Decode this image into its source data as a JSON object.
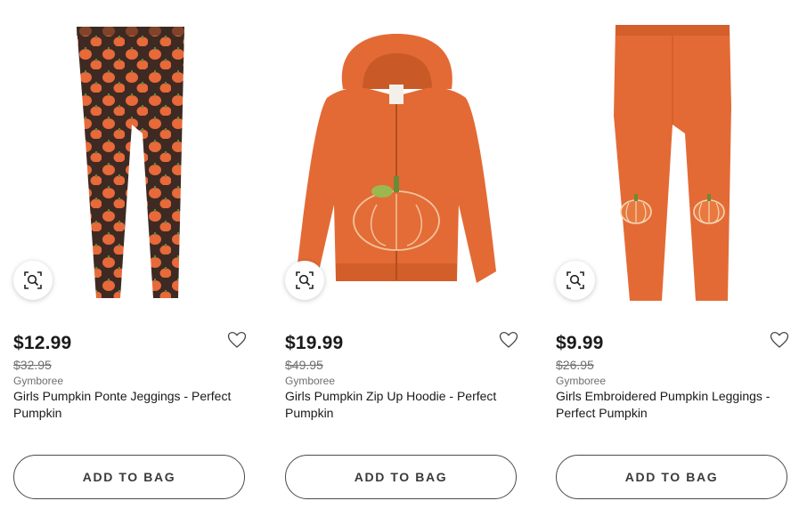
{
  "colors": {
    "accent": "#e8693a",
    "pumpkin_dark": "#cf5a24",
    "legging_print_bg": "#3e2a22",
    "stem_green": "#5e8b3a",
    "text": "#1a1a1a",
    "muted": "#6f6f6f"
  },
  "products": [
    {
      "image_icon": "pumpkin-print-leggings-image",
      "quickview_icon": "search-zoom-icon",
      "favorite_icon": "heart-outline-icon",
      "price": "$12.99",
      "original_price": "$32.95",
      "brand": "Gymboree",
      "title": "Girls Pumpkin Ponte Jeggings - Perfect Pumpkin",
      "cta": "ADD TO BAG"
    },
    {
      "image_icon": "pumpkin-zip-hoodie-image",
      "quickview_icon": "search-zoom-icon",
      "favorite_icon": "heart-outline-icon",
      "price": "$19.99",
      "original_price": "$49.95",
      "brand": "Gymboree",
      "title": "Girls Pumpkin Zip Up Hoodie - Perfect Pumpkin",
      "cta": "ADD TO BAG"
    },
    {
      "image_icon": "embroidered-pumpkin-leggings-image",
      "quickview_icon": "search-zoom-icon",
      "favorite_icon": "heart-outline-icon",
      "price": "$9.99",
      "original_price": "$26.95",
      "brand": "Gymboree",
      "title": "Girls Embroidered Pumpkin Leggings - Perfect Pumpkin",
      "cta": "ADD TO BAG"
    }
  ]
}
